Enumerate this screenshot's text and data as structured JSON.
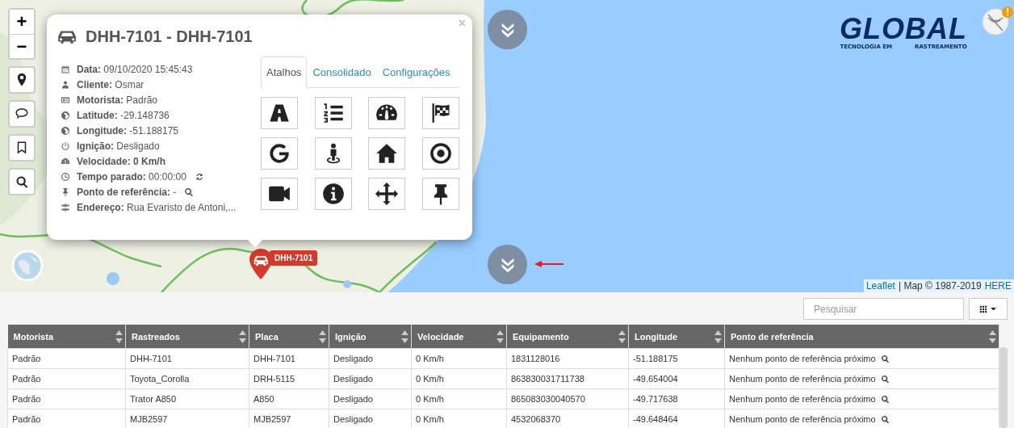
{
  "map": {
    "zoom_in": "+",
    "zoom_out": "−",
    "marker_label": "DHH-7101",
    "logo": {
      "name": "GLOBAL",
      "tagline_left": "TECNOLOGIA EM",
      "tagline_right": "RASTREAMENTO"
    },
    "attribution": {
      "link": "Leaflet",
      "text": "| Map © 1987-2019",
      "provider": "HERE"
    }
  },
  "popup": {
    "title": "DHH-7101 - DHH-7101",
    "close": "×",
    "fields": [
      {
        "text": "**Data:** 09/10/2020 15:45:43",
        "emphasis": false,
        "kind": "plain"
      },
      {
        "text": "**Cliente:** Osmar",
        "emphasis": false,
        "kind": "plain"
      },
      {
        "text": "**Motorista:** Padrão",
        "emphasis": false,
        "kind": "plain"
      },
      {
        "text": "**Latitude:** -29.148736",
        "emphasis": false,
        "kind": "plain"
      },
      {
        "text": "**Longitude:** -51.188175",
        "emphasis": false,
        "kind": "plain"
      },
      {
        "text": "**Ignição:** Desligado",
        "emphasis": false,
        "kind": "plain"
      },
      {
        "text": "Velocidade: 0 Km/h",
        "emphasis": true,
        "kind": "plain"
      },
      {
        "text": "**Tempo parado:** 00:00:00",
        "emphasis": false,
        "kind": "refresh"
      },
      {
        "text": "**Ponto de referência:** -",
        "emphasis": false,
        "kind": "search"
      },
      {
        "text": "**Endereço:** Rua Evaristo de Antoni,...",
        "emphasis": false,
        "kind": "plain"
      }
    ],
    "tabs": [
      {
        "label": "Atalhos",
        "selected": true
      },
      {
        "label": "Consolidado",
        "selected": false
      },
      {
        "label": "Configurações",
        "selected": false
      }
    ]
  },
  "table": {
    "search": {
      "placeholder": "Pesquisar"
    },
    "columns": [
      "Motorista",
      "Rastreados",
      "Placa",
      "Ignição",
      "Velocidade",
      "Equipamento",
      "Longitude",
      "Ponto de referência"
    ],
    "rows": [
      [
        "Padrão",
        "DHH-7101",
        "DHH-7101",
        "Desligado",
        "0 Km/h",
        "1831128016",
        "-51.188175",
        "Nenhum ponto de referência próximo"
      ],
      [
        "Padrão",
        "Toyota_Corolla",
        "DRH-5115",
        "Desligado",
        "0 Km/h",
        "863830031711738",
        "-49.654004",
        "Nenhum ponto de referência próximo"
      ],
      [
        "Padrão",
        "Trator A850",
        "A850",
        "Desligado",
        "0 Km/h",
        "865083030040570",
        "-49.717638",
        "Nenhum ponto de referência próximo"
      ],
      [
        "Padrão",
        "MJB2597",
        "MJB2597",
        "Desligado",
        "0 Km/h",
        "4532068370",
        "-49.648464",
        "Nenhum ponto de referência próximo"
      ]
    ]
  }
}
